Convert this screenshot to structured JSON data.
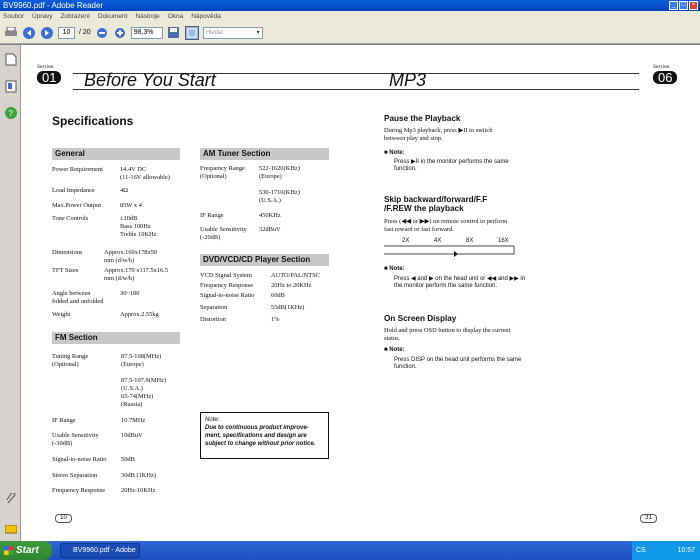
{
  "window": {
    "title": "BV9960.pdf - Adobe Reader"
  },
  "menu": [
    "Soubor",
    "Úpravy",
    "Zobrazení",
    "Dokument",
    "Nástroje",
    "Okna",
    "Nápověda"
  ],
  "toolbar": {
    "page_current": "10",
    "page_total": "/ 20",
    "zoom": "98,3%",
    "search_placeholder": "Hledat"
  },
  "header": {
    "left_section_label": "Section",
    "left_section_num": "01",
    "left_title": "Before You Start",
    "right_title": "MP3",
    "right_section_label": "Section",
    "right_section_num": "06"
  },
  "specs": {
    "title": "Specifications",
    "general": {
      "heading": "General",
      "rows": [
        {
          "label": "Power Requirement",
          "value": "14.4V DC\n(11-16V allowable)"
        },
        {
          "label": "Load Impedance",
          "value": "4Ω"
        },
        {
          "label": "Max.Power Output",
          "value": "85W x 4"
        },
        {
          "label": "Tone Controls",
          "value": "±10dB\nBass 100Hz\nTreble 10KHz"
        },
        {
          "label": "Dimensions",
          "value": "Approx.160x178x50\nmm (d/w/h)"
        },
        {
          "label": "TFT Sizes",
          "value": "Approx.170 x117.5x16.5\nmm (d/w/h)"
        },
        {
          "label": "Angle between\nfolded and unfolded",
          "value": "30~100"
        },
        {
          "label": "Weight",
          "value": "Approx.2.55kg"
        }
      ]
    },
    "fm": {
      "heading": "FM Section",
      "rows": [
        {
          "label": "Tuning Range\n(Optional)",
          "value": "87.5-108(MHz)\n(Europe)\n\n87.5-107.9(MHz)\n(U.S.A.)\n65-74(MHz)\n(Russia)"
        },
        {
          "label": "IF Range",
          "value": "10.7MHz"
        },
        {
          "label": "Usable Sensitivity\n(-30dB)",
          "value": "10dBuV"
        },
        {
          "label": "Signal-to-noise Ratio",
          "value": "50dB"
        },
        {
          "label": "Stereo Separation",
          "value": "30dB (1KHz)"
        },
        {
          "label": "Frequency Response",
          "value": "20Hz-10KHz"
        }
      ]
    },
    "am": {
      "heading": "AM Tuner Section",
      "rows": [
        {
          "label": "Frequency Range\n(Optional)",
          "value": "522-1620(KHz)\n(Europe)\n\n530-1710(KHz)\n(U.S.A.)"
        },
        {
          "label": "IF Range",
          "value": "450KHz"
        },
        {
          "label": "Usable Sensitivity\n(-20dB)",
          "value": "32dBuV"
        }
      ]
    },
    "dvd": {
      "heading": "DVD/VCD/CD Player Section",
      "rows": [
        {
          "label": "VCD Signal System",
          "value": "AUTO/PAL/NTSC"
        },
        {
          "label": "Frequency Response",
          "value": "20Hz  to 20KHz"
        },
        {
          "label": "Signal-to-noise Ratio",
          "value": "60dB"
        },
        {
          "label": "Separation",
          "value": "55dB(1KHz)"
        },
        {
          "label": "Distortion",
          "value": "1%"
        }
      ]
    },
    "note_title": "Note:",
    "note_body": "Due to continuous product improve-ment, specifications and design are subject to change without prior notice."
  },
  "mp3": {
    "pause_title": "Pause the Playback",
    "pause_body": "During Mp3 playback, press ▶II to switch between play and stop.",
    "note_label": "Note:",
    "pause_note": "Press ▶II in the monitor performs the same function.",
    "skip_title": "Skip backward/forward/F.F /F.REW the playback",
    "skip_body": "Press (◀◀ or ▶▶) on remote control to perform fast reward or fast forward.",
    "flow": [
      "2X",
      "4X",
      "8X",
      "16X"
    ],
    "skip_note": "Press ◀ and ▶ on the head unit or ◀◀ and ▶▶ in the monitor perform the same function.",
    "osd_title": "On Screen Display",
    "osd_body": "Hold and press OSD button to display the current status.",
    "osd_note": "Press DISP on the head unit performs the same function."
  },
  "page_left": "10",
  "page_right": "31",
  "taskbar": {
    "start": "Start",
    "task": "BV9960.pdf - Adobe ...",
    "lang": "CS",
    "time": "10:57"
  }
}
